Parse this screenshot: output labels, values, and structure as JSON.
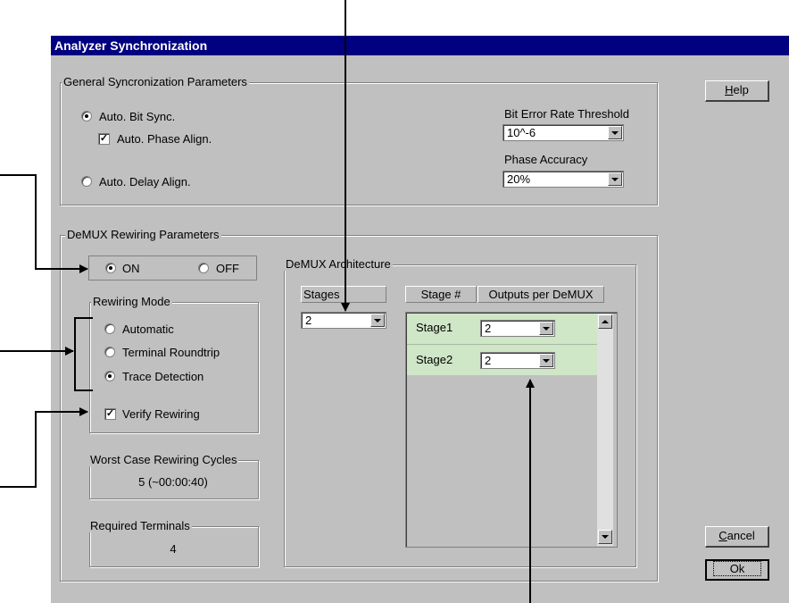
{
  "window": {
    "title": "Analyzer Synchronization"
  },
  "general": {
    "group_label": "General Syncronization Parameters",
    "auto_bit_sync": {
      "label": "Auto. Bit Sync.",
      "selected": true
    },
    "auto_phase_align": {
      "label": "Auto. Phase Align.",
      "checked": true
    },
    "auto_delay_align": {
      "label": "Auto. Delay Align.",
      "selected": false
    },
    "ber_threshold": {
      "label": "Bit Error Rate Threshold",
      "value": "10^-6"
    },
    "phase_accuracy": {
      "label": "Phase Accuracy",
      "value": "20%"
    }
  },
  "demux": {
    "group_label": "DeMUX Rewiring Parameters",
    "on_label": "ON",
    "off_label": "OFF",
    "on_selected": true,
    "rewiring_mode": {
      "group_label": "Rewiring Mode",
      "options": [
        {
          "label": "Automatic",
          "selected": false
        },
        {
          "label": "Terminal Roundtrip",
          "selected": false
        },
        {
          "label": "Trace Detection",
          "selected": true
        }
      ]
    },
    "verify_rewiring": {
      "label": "Verify Rewiring",
      "checked": true
    },
    "worst_case": {
      "label": "Worst Case Rewiring Cycles",
      "value": "5 (~00:00:40)"
    },
    "required_terminals": {
      "label": "Required Terminals",
      "value": "4"
    },
    "architecture": {
      "group_label": "DeMUX Architecture",
      "stages_label": "Stages",
      "stages_value": "2",
      "columns": [
        "Stage #",
        "Outputs per DeMUX"
      ],
      "rows": [
        {
          "stage": "Stage1",
          "outputs": "2"
        },
        {
          "stage": "Stage2",
          "outputs": "2"
        }
      ]
    }
  },
  "buttons": {
    "help": {
      "label": "Help",
      "mnemonic": "H",
      "rest": "elp"
    },
    "cancel": {
      "label": "Cancel",
      "mnemonic": "C",
      "rest": "ancel"
    },
    "ok": {
      "label": "Ok"
    }
  },
  "colors": {
    "titlebar": "#000080",
    "dialog": "#c0c0c0",
    "row_highlight": "#cfe6c7",
    "annotation": "#000000"
  }
}
